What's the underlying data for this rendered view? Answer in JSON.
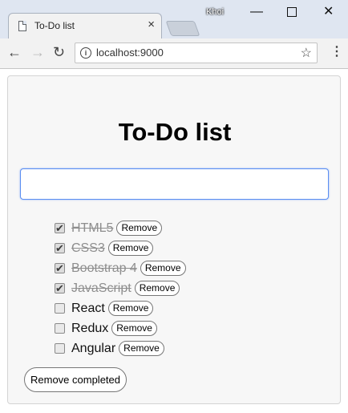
{
  "browser": {
    "tab_title": "To-Do list",
    "tab_close": "×",
    "user_label": "Khoi",
    "minimize": "—",
    "close": "✕",
    "back": "←",
    "forward": "→",
    "reload": "↻",
    "url": "localhost:9000",
    "info_icon": "i",
    "star_icon": "☆",
    "menu_icon": "⋮"
  },
  "app": {
    "heading": "To-Do list",
    "input": {
      "value": "",
      "placeholder": ""
    },
    "items": [
      {
        "label": "HTML5",
        "done": true,
        "remove": "Remove"
      },
      {
        "label": "CSS3",
        "done": true,
        "remove": "Remove"
      },
      {
        "label": "Bootstrap 4",
        "done": true,
        "remove": "Remove"
      },
      {
        "label": "JavaScript",
        "done": true,
        "remove": "Remove"
      },
      {
        "label": "React",
        "done": false,
        "remove": "Remove"
      },
      {
        "label": "Redux",
        "done": false,
        "remove": "Remove"
      },
      {
        "label": "Angular",
        "done": false,
        "remove": "Remove"
      }
    ],
    "remove_completed": "Remove completed"
  }
}
